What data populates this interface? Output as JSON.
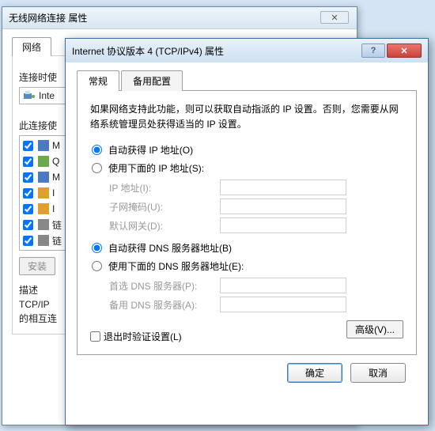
{
  "back": {
    "title": "无线网络连接 属性",
    "tab_network": "网络",
    "connect_using_label": "连接时使",
    "adapter_prefix": "Inte",
    "items_label": "此连接使",
    "items": [
      {
        "checked": true,
        "label": "M",
        "icon": "client"
      },
      {
        "checked": true,
        "label": "Q",
        "icon": "protocol"
      },
      {
        "checked": true,
        "label": "M",
        "icon": "client"
      },
      {
        "checked": true,
        "label": "I",
        "icon": "protocol"
      },
      {
        "checked": true,
        "label": "I",
        "icon": "protocol"
      },
      {
        "checked": true,
        "label": "链",
        "icon": "driver"
      },
      {
        "checked": true,
        "label": "链",
        "icon": "driver"
      }
    ],
    "install_btn": "安装",
    "desc_label": "描述",
    "desc_text": "TCP/IP\n的相互连"
  },
  "front": {
    "title": "Internet 协议版本 4 (TCP/IPv4) 属性",
    "tabs": {
      "general": "常规",
      "alt": "备用配置"
    },
    "intro": "如果网络支持此功能，则可以获取自动指派的 IP 设置。否则，您需要从网络系统管理员处获得适当的 IP 设置。",
    "ip": {
      "auto_label": "自动获得 IP 地址(O)",
      "manual_label": "使用下面的 IP 地址(S):",
      "addr": "IP 地址(I):",
      "mask": "子网掩码(U):",
      "gw": "默认网关(D):"
    },
    "dns": {
      "auto_label": "自动获得 DNS 服务器地址(B)",
      "manual_label": "使用下面的 DNS 服务器地址(E):",
      "pref": "首选 DNS 服务器(P):",
      "alt": "备用 DNS 服务器(A):"
    },
    "validate": "退出时验证设置(L)",
    "advanced": "高级(V)...",
    "ok": "确定",
    "cancel": "取消"
  }
}
